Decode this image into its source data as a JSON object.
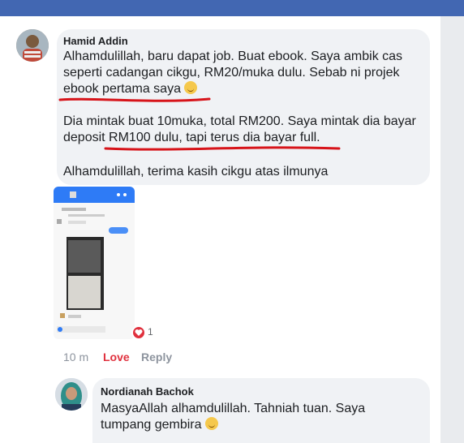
{
  "comment1": {
    "author": "Hamid Addin",
    "line1": "Alhamdulillah, baru dapat job. Buat ebook. Saya ambik cas",
    "line2": "seperti cadangan cikgu, RM20/muka dulu. Sebab ni projek",
    "line3": "ebook pertama saya",
    "line4": "Dia mintak buat 10muka, total RM200. Saya mintak dia bayar",
    "line5": "deposit RM100 dulu, tapi terus dia bayar full.",
    "line6": "Alhamdulillah, terima kasih cikgu atas ilmunya",
    "time": "10 m",
    "love_label": "Love",
    "reply_label": "Reply",
    "reaction_count": "1"
  },
  "comment2": {
    "author": "Nordianah Bachok",
    "line1": "MasyaAllah alhamdulillah. Tahniah tuan. Saya",
    "line2": "tumpang gembira"
  },
  "colors": {
    "header": "#4267b2",
    "bubble": "#f0f2f5",
    "love": "#e0303d",
    "underline": "#d7141a"
  },
  "icons": [
    "avatar",
    "smile-emoji-icon",
    "heart-reaction-icon"
  ]
}
